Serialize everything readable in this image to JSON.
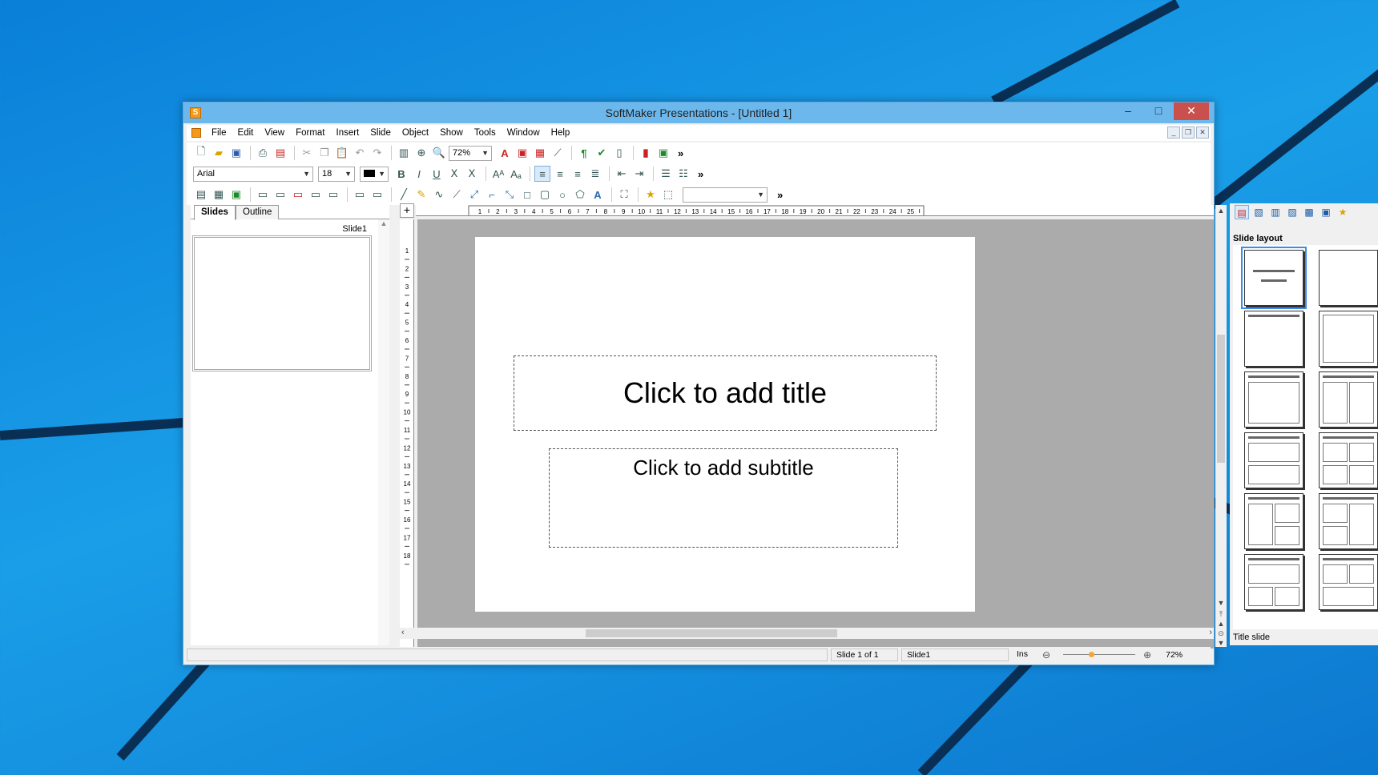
{
  "window": {
    "title": "SoftMaker Presentations - [Untitled 1]"
  },
  "menu": [
    "File",
    "Edit",
    "View",
    "Format",
    "Insert",
    "Slide",
    "Object",
    "Show",
    "Tools",
    "Window",
    "Help"
  ],
  "toolbar1": {
    "zoom": "72%"
  },
  "toolbar2": {
    "font": "Arial",
    "size": "18"
  },
  "left_panel": {
    "tabs": [
      "Slides",
      "Outline"
    ],
    "slide_label": "Slide1"
  },
  "ruler": {
    "h_ticks": [
      "1",
      "2",
      "3",
      "4",
      "5",
      "6",
      "7",
      "8",
      "9",
      "10",
      "11",
      "12",
      "13",
      "14",
      "15",
      "16",
      "17",
      "18",
      "19",
      "20",
      "21",
      "22",
      "23",
      "24",
      "25"
    ],
    "v_ticks": [
      "1",
      "2",
      "3",
      "4",
      "5",
      "6",
      "7",
      "8",
      "9",
      "10",
      "11",
      "12",
      "13",
      "14",
      "15",
      "16",
      "17",
      "18"
    ]
  },
  "slide": {
    "title": "Click to add title",
    "subtitle": "Click to add subtitle"
  },
  "right_panel": {
    "title": "Slide layout",
    "selected": "Title slide"
  },
  "status": {
    "position": "Slide 1 of 1",
    "slide": "Slide1",
    "mode": "Ins",
    "zoom": "72%"
  },
  "colors": {
    "desktop": "#1a9ee8",
    "titlebar": "#6cb8ed",
    "close": "#c9504c",
    "canvas": "#ababab"
  },
  "icons": {
    "toolbar1": [
      "new-icon",
      "open-icon",
      "save-icon",
      "print-icon",
      "pdf-icon",
      "cut-icon",
      "copy-icon",
      "paste-icon",
      "undo-icon",
      "redo-icon",
      "chart-icon",
      "zoom-in-icon",
      "zoom-icon",
      "text-icon",
      "image-icon",
      "table-icon",
      "brush-icon",
      "pilcrow-icon",
      "spellcheck-icon",
      "chart-bars-icon",
      "close-red-icon",
      "export-icon"
    ],
    "toolbar2": [
      "bold-icon",
      "italic-icon",
      "underline-icon",
      "strike-icon",
      "x-icon",
      "superscript-icon",
      "subscript-icon",
      "align-left-icon",
      "align-center-icon",
      "align-right-icon",
      "justify-icon",
      "outdent-icon",
      "indent-icon",
      "bullets-icon",
      "numbering-icon"
    ],
    "toolbar3": [
      "layout1-icon",
      "layout2-icon",
      "layout3-icon",
      "layout4-icon",
      "layout5-icon",
      "layout6-icon",
      "layout7-icon",
      "layout8-icon",
      "layout9-icon",
      "layout10-icon",
      "line-icon",
      "pen-icon",
      "curve-icon",
      "freehand-icon",
      "connector-icon",
      "elbow-icon",
      "connector2-icon",
      "rect-icon",
      "rounded-rect-icon",
      "ellipse-icon",
      "shapes-icon",
      "textart-icon",
      "group-icon",
      "effect-icon",
      "star-icon",
      "select-icon"
    ],
    "right_toolbar": [
      "layout-icon",
      "design-icon",
      "chart-icon",
      "background-icon",
      "transition-icon",
      "animation-icon",
      "star-icon"
    ]
  }
}
